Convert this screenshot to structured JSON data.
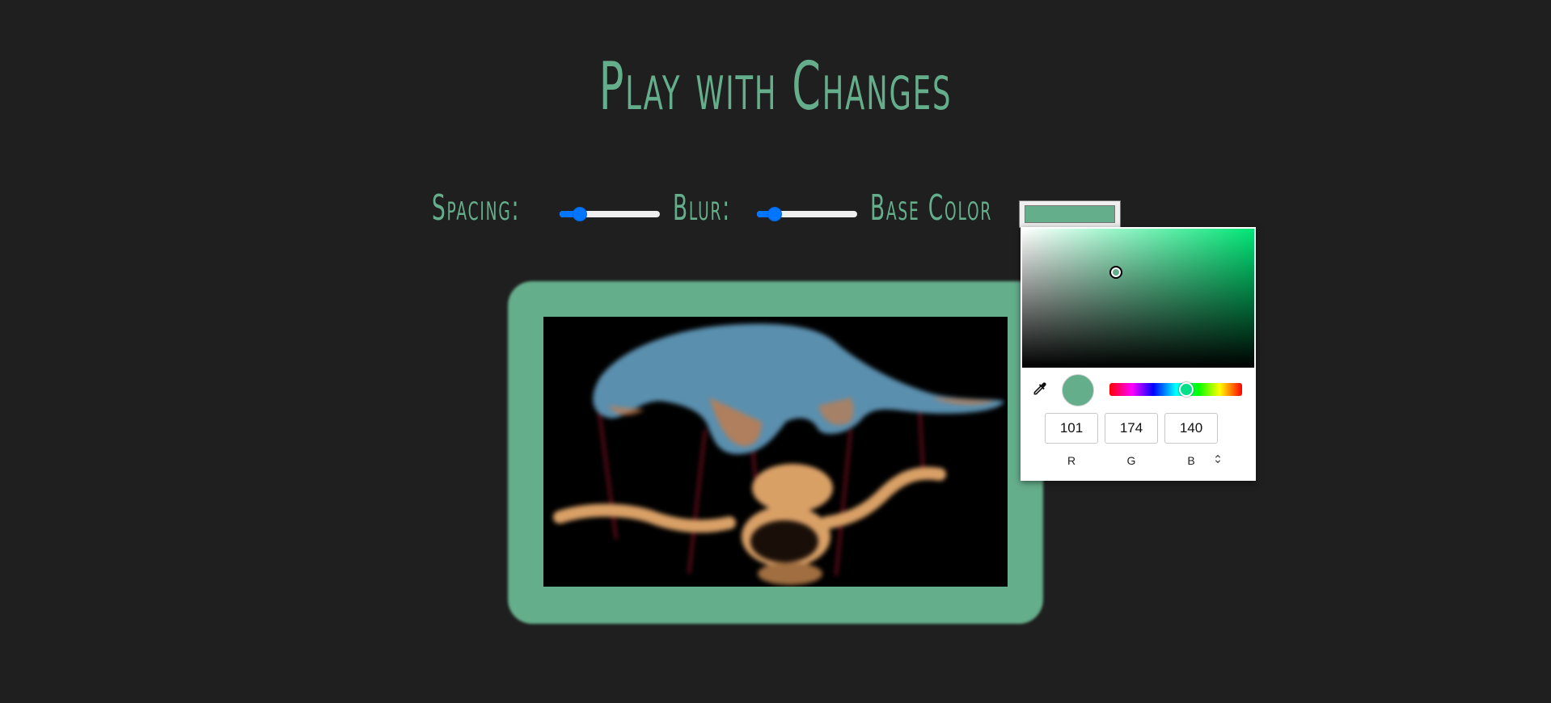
{
  "page": {
    "title": "Play with Changes"
  },
  "controls": {
    "spacing_label": "Spacing:",
    "blur_label": "Blur:",
    "base_color_label": "Base Color",
    "spacing_value_fraction": 0.15,
    "blur_value_fraction": 0.12,
    "base_color": "#65ae8c"
  },
  "image": {
    "description_icon": "puppet-hand-image"
  },
  "color_picker": {
    "r": "101",
    "g": "174",
    "b": "140",
    "r_label": "R",
    "g_label": "G",
    "b_label": "B",
    "format_toggle_icon": "⌃⌄",
    "hue_color": "#00e676",
    "icons": [
      "eyedropper-icon",
      "format-toggle-icon"
    ]
  },
  "colors": {
    "background": "#1f1f1f",
    "accent": "#65ae8c",
    "slider_blue": "#0075ff"
  }
}
